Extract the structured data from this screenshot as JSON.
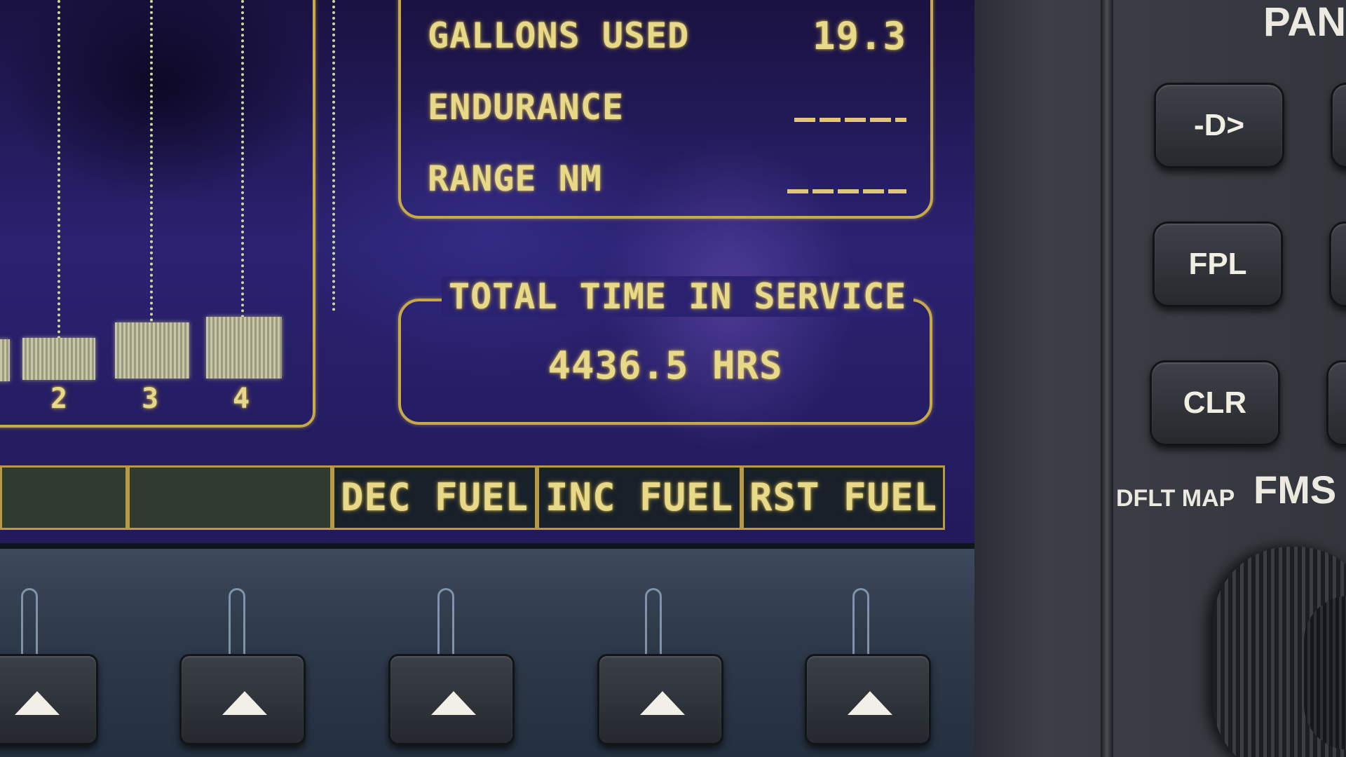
{
  "bar_graph": {
    "bars": [
      {
        "label": ""
      },
      {
        "label": "2"
      },
      {
        "label": "3"
      },
      {
        "label": "4"
      }
    ]
  },
  "fuel": {
    "gallons_used_label": "GALLONS USED",
    "gallons_used_value": "19.3",
    "endurance_label": "ENDURANCE",
    "endurance_value": "",
    "range_label": "RANGE NM",
    "range_value": ""
  },
  "total_time": {
    "title": "TOTAL TIME IN SERVICE",
    "value": "4436.5 HRS"
  },
  "softkeys": {
    "labels": [
      "",
      "",
      "DEC FUEL",
      "INC FUEL",
      "RST FUEL"
    ]
  },
  "bezel": {
    "pan_label": "PAN",
    "direct_to_label": "-D>",
    "fpl_label": "FPL",
    "clr_label": "CLR",
    "dflt_map_label": "DFLT MAP",
    "fms_label": "FMS"
  },
  "colors": {
    "text_glow": "#e8d98a",
    "frame": "#c7a84a",
    "screen_bg": "#2a2270"
  }
}
